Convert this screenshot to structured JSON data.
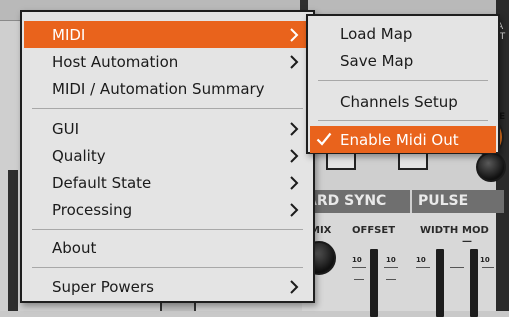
{
  "background": {
    "right_label": "A\nIT",
    "hdr_sync": "ARD SYNC",
    "hdr_pulse": "PULSE",
    "col_mix": "MIX",
    "col_offset": "OFFSET",
    "col_width": "WIDTH",
    "col_mod": "MOD—",
    "tick_10": "10",
    "side_label": "E"
  },
  "main_menu": {
    "items": [
      {
        "label": "MIDI",
        "has_submenu": true,
        "active": true
      },
      {
        "label": "Host Automation",
        "has_submenu": true
      },
      {
        "label": "MIDI / Automation Summary",
        "has_submenu": false
      },
      {
        "label": "GUI",
        "has_submenu": true
      },
      {
        "label": "Quality",
        "has_submenu": true
      },
      {
        "label": "Default State",
        "has_submenu": true
      },
      {
        "label": "Processing",
        "has_submenu": true
      },
      {
        "label": "About",
        "has_submenu": false
      },
      {
        "label": "Super Powers",
        "has_submenu": true
      }
    ]
  },
  "sub_menu": {
    "items": [
      {
        "label": "Load Map"
      },
      {
        "label": "Save Map"
      },
      {
        "label": "Channels Setup"
      },
      {
        "label": "Enable Midi Out",
        "checked": true,
        "active": true
      }
    ]
  },
  "colors": {
    "accent": "#e9631c",
    "menu_bg": "#e4e4e4",
    "menu_border": "#1e1e1e",
    "knob_orange": "#e8751e"
  },
  "icons": {
    "submenu": "chevron-right-icon",
    "check": "checkmark-icon"
  }
}
